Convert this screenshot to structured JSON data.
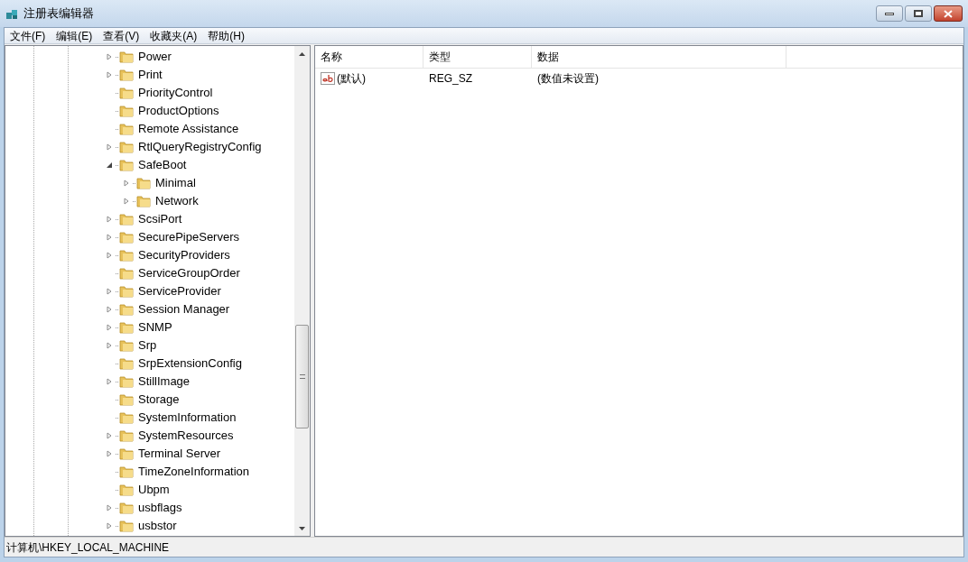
{
  "window": {
    "title": "注册表编辑器"
  },
  "menu": [
    "文件(F)",
    "编辑(E)",
    "查看(V)",
    "收藏夹(A)",
    "帮助(H)"
  ],
  "tree": [
    {
      "label": "Power",
      "expandable": true,
      "expanded": false
    },
    {
      "label": "Print",
      "expandable": true,
      "expanded": false
    },
    {
      "label": "PriorityControl",
      "expandable": false,
      "expanded": false
    },
    {
      "label": "ProductOptions",
      "expandable": false,
      "expanded": false
    },
    {
      "label": "Remote Assistance",
      "expandable": false,
      "expanded": false
    },
    {
      "label": "RtlQueryRegistryConfig",
      "expandable": true,
      "expanded": false
    },
    {
      "label": "SafeBoot",
      "expandable": true,
      "expanded": true,
      "children": [
        {
          "label": "Minimal",
          "expandable": true,
          "expanded": false
        },
        {
          "label": "Network",
          "expandable": true,
          "expanded": false
        }
      ]
    },
    {
      "label": "ScsiPort",
      "expandable": true,
      "expanded": false
    },
    {
      "label": "SecurePipeServers",
      "expandable": true,
      "expanded": false
    },
    {
      "label": "SecurityProviders",
      "expandable": true,
      "expanded": false
    },
    {
      "label": "ServiceGroupOrder",
      "expandable": false,
      "expanded": false
    },
    {
      "label": "ServiceProvider",
      "expandable": true,
      "expanded": false
    },
    {
      "label": "Session Manager",
      "expandable": true,
      "expanded": false
    },
    {
      "label": "SNMP",
      "expandable": true,
      "expanded": false
    },
    {
      "label": "Srp",
      "expandable": true,
      "expanded": false
    },
    {
      "label": "SrpExtensionConfig",
      "expandable": false,
      "expanded": false
    },
    {
      "label": "StillImage",
      "expandable": true,
      "expanded": false
    },
    {
      "label": "Storage",
      "expandable": false,
      "expanded": false
    },
    {
      "label": "SystemInformation",
      "expandable": false,
      "expanded": false
    },
    {
      "label": "SystemResources",
      "expandable": true,
      "expanded": false
    },
    {
      "label": "Terminal Server",
      "expandable": true,
      "expanded": false
    },
    {
      "label": "TimeZoneInformation",
      "expandable": false,
      "expanded": false
    },
    {
      "label": "Ubpm",
      "expandable": false,
      "expanded": false
    },
    {
      "label": "usbflags",
      "expandable": true,
      "expanded": false
    },
    {
      "label": "usbstor",
      "expandable": true,
      "expanded": false
    }
  ],
  "table": {
    "columns": [
      "名称",
      "类型",
      "数据"
    ],
    "rows": [
      {
        "name": "(默认)",
        "type": "REG_SZ",
        "data": "(数值未设置)"
      }
    ]
  },
  "status_bar": "计算机\\HKEY_LOCAL_MACHINE"
}
